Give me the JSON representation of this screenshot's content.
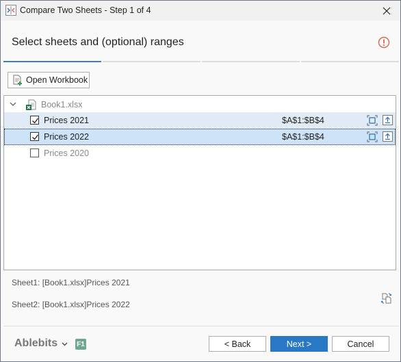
{
  "window": {
    "title": "Compare Two Sheets - Step 1 of 4",
    "app_icon": "compare-sheets-icon",
    "close_icon": "close-icon"
  },
  "header": {
    "title": "Select sheets and (optional) ranges",
    "warning_icon": "warning-icon",
    "steps_total": 4,
    "current_step": 1
  },
  "toolbar": {
    "open_workbook_label": "Open Workbook"
  },
  "tree": {
    "workbook": {
      "name": "Book1.xlsx",
      "expanded": true
    },
    "sheets": [
      {
        "name": "Prices 2021",
        "checked": true,
        "range": "$A$1:$B$4",
        "selected": false
      },
      {
        "name": "Prices 2022",
        "checked": true,
        "range": "$A$1:$B$4",
        "selected": true
      },
      {
        "name": "Prices 2020",
        "checked": false,
        "range": "",
        "selected": false
      }
    ]
  },
  "summary": {
    "sheet1": "Sheet1: [Book1.xlsx]Prices 2021",
    "sheet2": "Sheet2: [Book1.xlsx]Prices 2022"
  },
  "footer": {
    "brand": "Ablebits",
    "help_badge": "F1",
    "back_label": "< Back",
    "next_label": "Next >",
    "cancel_label": "Cancel"
  },
  "colors": {
    "accent": "#2878c6",
    "step_active": "#3e7bbf",
    "row_selected": "#cde3f7",
    "row_checked": "#e0ebf5",
    "warning": "#d9654a",
    "help_badge": "#6fa890"
  }
}
